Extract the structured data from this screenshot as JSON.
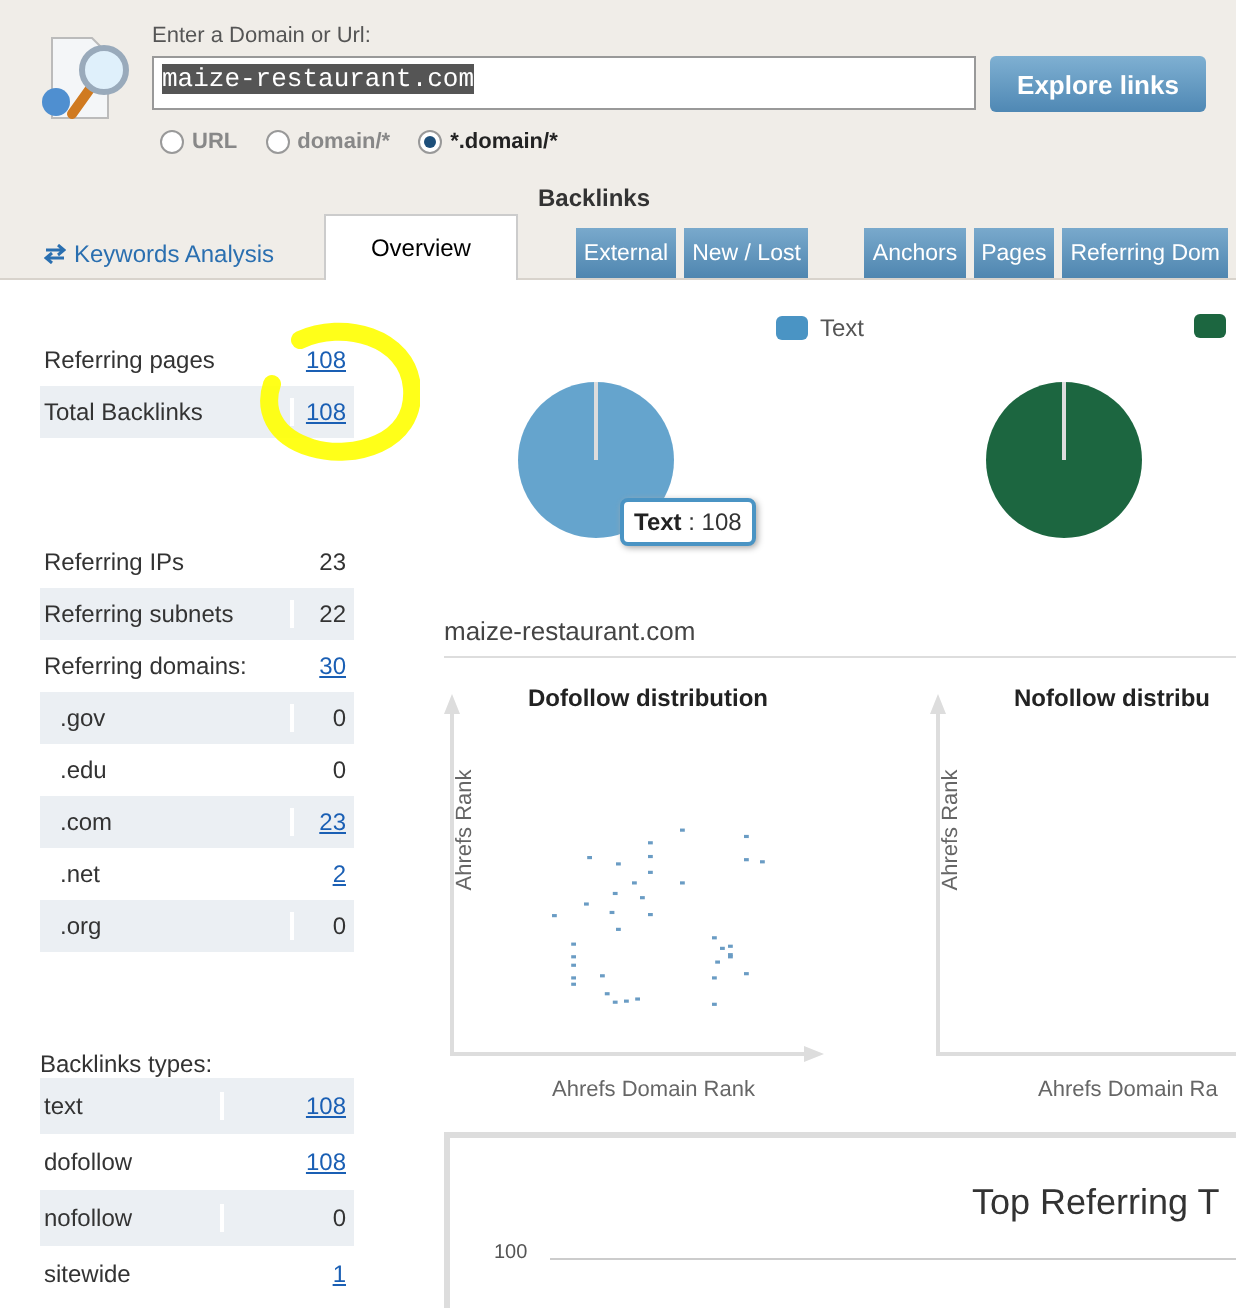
{
  "search": {
    "label": "Enter a Domain or Url:",
    "value": "maize-restaurant.com",
    "button": "Explore links"
  },
  "scope_options": [
    {
      "label": "URL",
      "selected": false
    },
    {
      "label": "domain/*",
      "selected": false
    },
    {
      "label": "*.domain/*",
      "selected": true
    }
  ],
  "section_title": "Backlinks",
  "keywords_link": "Keywords Analysis",
  "tabs": [
    {
      "label": "Overview",
      "selected": true,
      "kind": "main"
    },
    {
      "label": "External",
      "selected": false,
      "kind": "sub"
    },
    {
      "label": "New / Lost",
      "selected": false,
      "kind": "sub"
    },
    {
      "label": "Anchors",
      "selected": false,
      "kind": "sub",
      "gap": true
    },
    {
      "label": "Pages",
      "selected": false,
      "kind": "sub"
    },
    {
      "label": "Referring Dom",
      "selected": false,
      "kind": "sub"
    }
  ],
  "stat_groups": [
    {
      "rows": [
        {
          "label": "Referring pages",
          "value": "108",
          "kind": "link"
        },
        {
          "label": "Total Backlinks",
          "value": "108",
          "kind": "link"
        }
      ]
    },
    {
      "rows": [
        {
          "label": "Referring IPs",
          "value": "23",
          "kind": "plain"
        },
        {
          "label": "Referring subnets",
          "value": "22",
          "kind": "plain"
        },
        {
          "label": "Referring domains:",
          "value": "30",
          "kind": "link"
        },
        {
          "label": ".gov",
          "value": "0",
          "kind": "plain",
          "indent": true
        },
        {
          "label": ".edu",
          "value": "0",
          "kind": "plain",
          "indent": true
        },
        {
          "label": ".com",
          "value": "23",
          "kind": "link",
          "indent": true
        },
        {
          "label": ".net",
          "value": "2",
          "kind": "link",
          "indent": true
        },
        {
          "label": ".org",
          "value": "0",
          "kind": "plain",
          "indent": true
        }
      ]
    },
    {
      "title": "Backlinks types:",
      "rows": [
        {
          "label": "text",
          "value": "108",
          "kind": "link"
        },
        {
          "label": "dofollow",
          "value": "108",
          "kind": "link"
        },
        {
          "label": "nofollow",
          "value": "0",
          "kind": "plain"
        },
        {
          "label": "sitewide",
          "value": "1",
          "kind": "link"
        }
      ]
    }
  ],
  "pies": [
    {
      "legend": "Text",
      "color": "#4a94c4",
      "tooltip_label": "Text",
      "tooltip_value": ": 108"
    },
    {
      "color": "#1c6640"
    }
  ],
  "domain_title": "maize-restaurant.com",
  "scatters": [
    {
      "title": "Dofollow distribution",
      "ylabel": "Ahrefs Rank",
      "xlabel": "Ahrefs Domain Rank",
      "points": true
    },
    {
      "title": "Nofollow distribu",
      "ylabel": "Ahrefs Rank",
      "xlabel": "Ahrefs Domain Ra",
      "points": false
    }
  ],
  "bottom_chart": {
    "title": "Top Referring T",
    "ytick": "100"
  }
}
